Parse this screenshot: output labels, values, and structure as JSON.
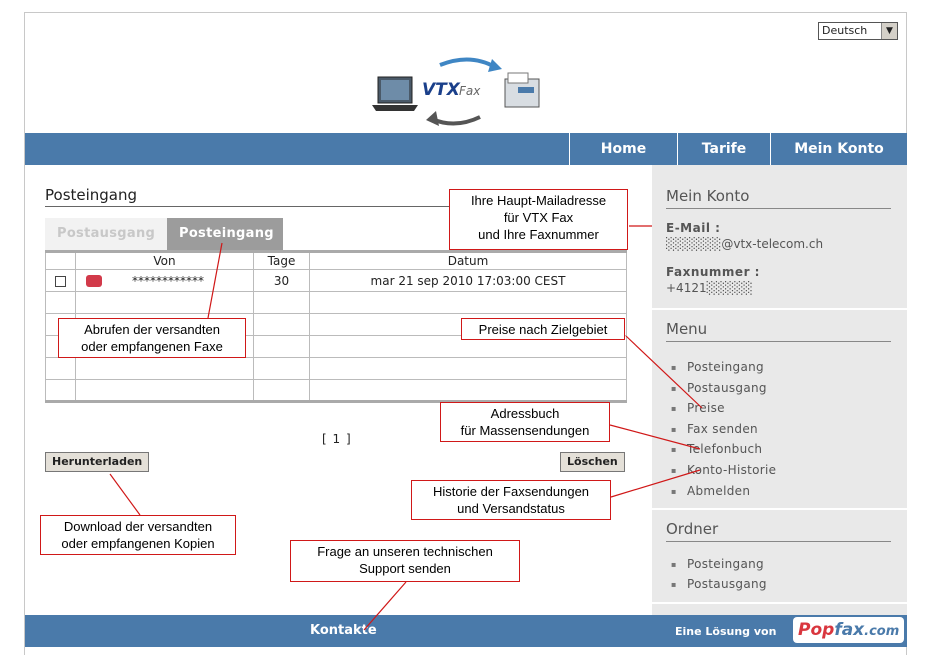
{
  "language": {
    "selected": "Deutsch"
  },
  "logo": {
    "text": "VTX",
    "text2": "Fax"
  },
  "nav": {
    "home": "Home",
    "tarife": "Tarife",
    "mein_konto": "Mein Konto"
  },
  "inbox": {
    "title": "Posteingang",
    "tabs": {
      "outbox": "Postausgang",
      "inbox": "Posteingang"
    },
    "columns": {
      "von": "Von",
      "tage": "Tage",
      "datum": "Datum"
    },
    "rows": [
      {
        "von": "************",
        "tage": "30",
        "datum": "mar 21 sep 2010 17:03:00 CEST"
      }
    ],
    "pager": "[ 1 ]",
    "download_label": "Herunterladen",
    "delete_label": "Löschen"
  },
  "sidebar": {
    "account_title": "Mein Konto",
    "email_label": "E-Mail :",
    "email_value": "░░░░░░@vtx-telecom.ch",
    "fax_label": "Faxnummer :",
    "fax_value": "+4121░░░░░",
    "menu_title": "Menu",
    "menu_items": [
      "Posteingang",
      "Postausgang",
      "Preise",
      "Fax senden",
      "Telefonbuch",
      "Konto-Historie",
      "Abmelden"
    ],
    "folders_title": "Ordner",
    "folder_items": [
      "Posteingang",
      "Postausgang"
    ]
  },
  "footer": {
    "contacts": "Kontakte",
    "credit": "Eine Lösung von",
    "brand": "Pop",
    "brand2": "fax",
    "brand3": ".com"
  },
  "callouts": {
    "email": "Ihre Haupt-Mailadresse\nfür VTX Fax\nund Ihre Faxnummer",
    "tabs": "Abrufen der versandten\noder empfangenen Faxe",
    "preise": "Preise nach Zielgebiet",
    "adressbuch": "Adressbuch\nfür Massensendungen",
    "historie": "Historie der Faxsendungen\nund Versandstatus",
    "download": "Download der versandten\noder empfangenen Kopien",
    "support": "Frage an unseren technischen\nSupport senden"
  },
  "colors": {
    "nav": "#4a7aaa",
    "callout_border": "#d01818",
    "sidebar": "#e9e9e9"
  }
}
